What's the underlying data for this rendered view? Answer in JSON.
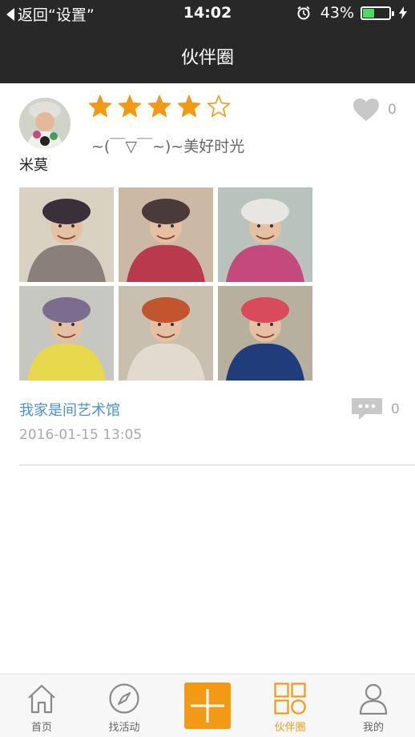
{
  "status_bar": {
    "back_label": "返回“设置”",
    "time": "14:02",
    "battery_text": "43%",
    "battery_level": 0.43
  },
  "nav": {
    "title": "伙伴圈"
  },
  "post": {
    "username": "米莫",
    "rating": 4,
    "rating_max": 5,
    "text": "~(￣▽￣~)~美好时光",
    "like_count": "0",
    "group_name": "我家是间艺术馆",
    "comment_count": "0",
    "timestamp": "2016-01-15 13:05",
    "photos": [
      {
        "bg": "#d9d2c3",
        "hat": "#3b2f3a",
        "scarf": "#8a7f7a"
      },
      {
        "bg": "#cbb9a6",
        "hat": "#4a3b3a",
        "scarf": "#b93a4c"
      },
      {
        "bg": "#b9c2bd",
        "hat": "#e8e6e0",
        "scarf": "#c44a7e"
      },
      {
        "bg": "#c7c7c2",
        "hat": "#7a6d8f",
        "scarf": "#e6d84a"
      },
      {
        "bg": "#c8bfae",
        "hat": "#c0552e",
        "scarf": "#e2d9cf"
      },
      {
        "bg": "#b7b09e",
        "hat": "#d84b5c",
        "scarf": "#213c7a"
      }
    ]
  },
  "tabs": [
    {
      "label": "首页",
      "icon": "home-icon",
      "active": false
    },
    {
      "label": "找活动",
      "icon": "compass-icon",
      "active": false
    },
    {
      "label": "伙伴圈",
      "icon": "grid-icon",
      "active": true
    },
    {
      "label": "我的",
      "icon": "person-icon",
      "active": false
    }
  ],
  "colors": {
    "accent": "#f29a16",
    "bar_bg": "#282828",
    "link": "#4a90d9",
    "muted": "#aaaaaa",
    "battery_green": "#4cd964"
  }
}
